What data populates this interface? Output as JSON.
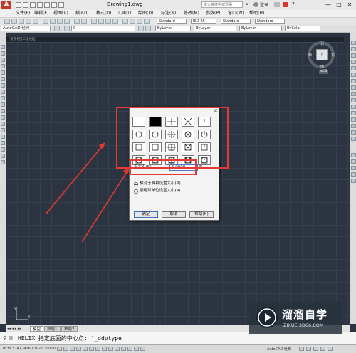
{
  "titlebar": {
    "doc_title": "Drawing1.dwg",
    "search_placeholder": "键入关键字或短语",
    "login_label": "登录",
    "min": "—",
    "max": "□",
    "close": "✕"
  },
  "menubar": {
    "items": [
      "文件(F)",
      "编辑(E)",
      "视图(V)",
      "插入(I)",
      "格式(O)",
      "工具(T)",
      "绘图(D)",
      "标注(N)",
      "修改(M)",
      "参数(P)",
      "窗口(W)",
      "帮助(H)"
    ]
  },
  "toolbar": {
    "workspace": "AutoCAD 经典",
    "text_style": "Standard",
    "dim_style": "ISO-25",
    "table_style": "Standard",
    "multileader_style": "Standard",
    "layer": "0",
    "color": "ByLayer",
    "linetype": "ByLayer",
    "lineweight": "ByLayer",
    "plot_style": "ByColor"
  },
  "drawing_tab": "[-][俯视][二维线框]",
  "viewcube": {
    "north": "北",
    "south": "南",
    "west": "西",
    "east": "东",
    "face": "上",
    "wcs": "WCS"
  },
  "dialog": {
    "close": "✕",
    "size_label": "点大小(S):",
    "size_value": "5.0000",
    "size_unit": "%",
    "radio_relative": "相对于屏幕设置大小(R)",
    "radio_absolute": "按绝对单位设置大小(A)",
    "ok": "确定",
    "cancel": "取消",
    "help": "帮助(H)"
  },
  "layout_tabs": [
    "模型",
    "布局1",
    "布局2"
  ],
  "command_line": {
    "text": "HELIX 指定底面的中心点: '_ddptype"
  },
  "statusbar": {
    "coords": "1635.5741, 4160.7927, 0.0000",
    "workspace_btn": "AutoCAD 经典"
  },
  "watermark": {
    "title": "溜溜自学",
    "url": "ZIXUE.3D66.COM"
  },
  "colors": {
    "annotation_red": "#e53935",
    "canvas": "#2b3440"
  }
}
